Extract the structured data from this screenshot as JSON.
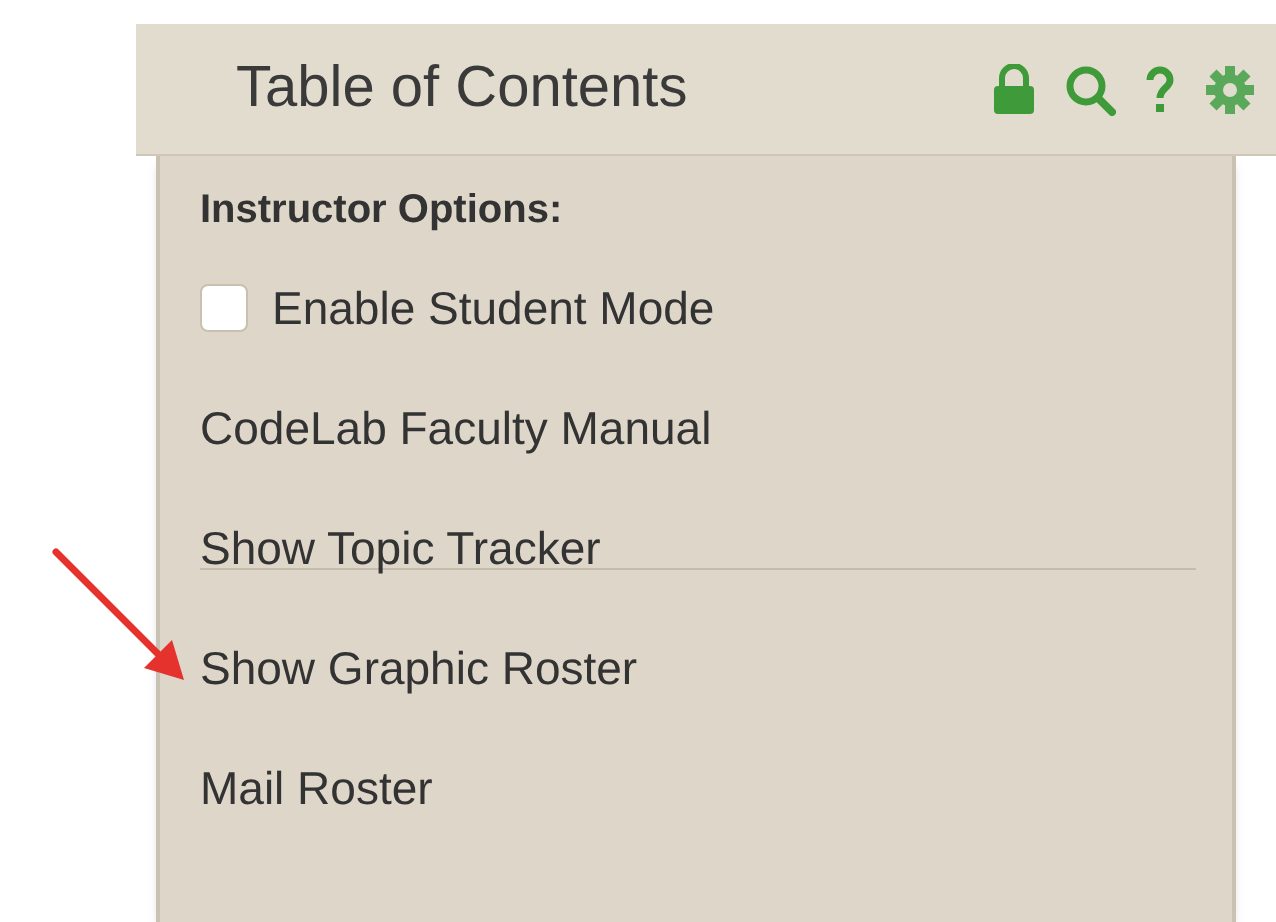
{
  "header": {
    "title": "Table of Contents"
  },
  "menu": {
    "heading": "Instructor Options:",
    "items": [
      {
        "kind": "checkbox",
        "label": "Enable Student Mode",
        "checked": false
      },
      {
        "kind": "link",
        "label": "CodeLab Faculty Manual"
      },
      {
        "kind": "link",
        "label": "Show Topic Tracker"
      },
      {
        "kind": "divider"
      },
      {
        "kind": "link",
        "label": "Show Graphic Roster"
      },
      {
        "kind": "link",
        "label": "Mail Roster"
      }
    ]
  }
}
